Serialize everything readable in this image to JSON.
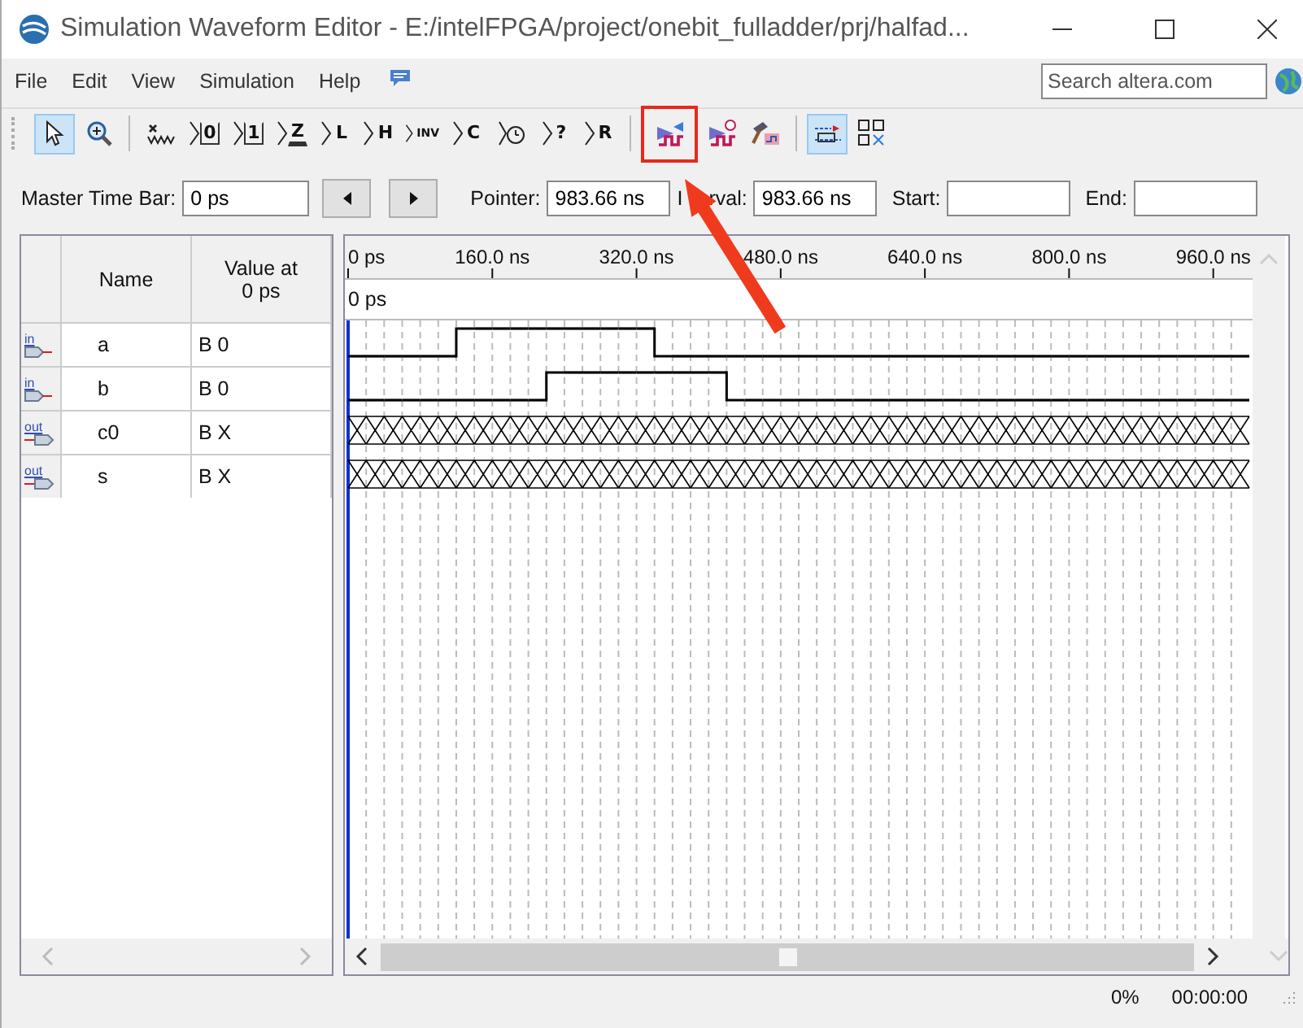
{
  "window": {
    "title": "Simulation Waveform Editor - E:/intelFPGA/project/onebit_fulladder/prj/halfad..."
  },
  "menu": [
    "File",
    "Edit",
    "View",
    "Simulation",
    "Help"
  ],
  "search": {
    "placeholder": "Search altera.com"
  },
  "toolbar": [
    {
      "kind": "pointer",
      "selected": true,
      "highlighted": false
    },
    {
      "kind": "zoom",
      "selected": false,
      "highlighted": false
    },
    {
      "kind": "separator"
    },
    {
      "kind": "unknown",
      "selected": false,
      "highlighted": false
    },
    {
      "kind": "level-low",
      "glyph": "0",
      "selected": false,
      "highlighted": false
    },
    {
      "kind": "level-high",
      "glyph": "1",
      "selected": false,
      "highlighted": false
    },
    {
      "kind": "level-z",
      "glyph": "Z",
      "selected": false,
      "highlighted": false
    },
    {
      "kind": "letter",
      "glyph": "L",
      "selected": false,
      "highlighted": false
    },
    {
      "kind": "letter",
      "glyph": "H",
      "selected": false,
      "highlighted": false
    },
    {
      "kind": "invert",
      "glyph": "INV",
      "selected": false,
      "highlighted": false
    },
    {
      "kind": "letter",
      "glyph": "C",
      "selected": false,
      "highlighted": false
    },
    {
      "kind": "clock",
      "selected": false,
      "highlighted": false
    },
    {
      "kind": "letter",
      "glyph": "?",
      "selected": false,
      "highlighted": false
    },
    {
      "kind": "letter",
      "glyph": "R",
      "selected": false,
      "highlighted": false
    },
    {
      "kind": "separator"
    },
    {
      "kind": "run-functional",
      "selected": false,
      "highlighted": true
    },
    {
      "kind": "run-timing",
      "selected": false,
      "highlighted": false
    },
    {
      "kind": "netlist",
      "selected": false,
      "highlighted": false
    },
    {
      "kind": "separator"
    },
    {
      "kind": "snap",
      "selected": true,
      "highlighted": false
    },
    {
      "kind": "grid",
      "selected": false,
      "highlighted": false
    }
  ],
  "annotation_arrow": true,
  "time_bar": {
    "master_label": "Master Time Bar:",
    "master_value": "0 ps",
    "pointer_label": "Pointer:",
    "pointer_value": "983.66 ns",
    "interval_label_parts": [
      "I",
      "rval:"
    ],
    "interval_value": "983.66 ns",
    "start_label": "Start:",
    "end_label": "End:"
  },
  "signal_table": {
    "columns": [
      "Name",
      "Value at\n0 ps"
    ],
    "rows": [
      {
        "direction": "in",
        "name": "a",
        "value": "B 0",
        "kind": "binary",
        "levels": [
          false,
          false,
          false,
          false,
          false,
          false,
          true,
          true,
          true,
          true,
          true,
          true,
          true,
          true,
          true,
          true,
          true,
          false,
          false,
          false,
          false,
          false,
          false,
          false,
          false,
          false,
          false,
          false,
          false,
          false,
          false,
          false,
          false,
          false,
          false,
          false,
          false,
          false,
          false,
          false,
          false,
          false,
          false,
          false,
          false,
          false,
          false,
          false,
          false,
          false
        ]
      },
      {
        "direction": "in",
        "name": "b",
        "value": "B 0",
        "kind": "binary",
        "levels": [
          false,
          false,
          false,
          false,
          false,
          false,
          false,
          false,
          false,
          false,
          false,
          true,
          true,
          true,
          true,
          true,
          true,
          true,
          true,
          true,
          true,
          false,
          false,
          false,
          false,
          false,
          false,
          false,
          false,
          false,
          false,
          false,
          false,
          false,
          false,
          false,
          false,
          false,
          false,
          false,
          false,
          false,
          false,
          false,
          false,
          false,
          false,
          false,
          false,
          false
        ]
      },
      {
        "direction": "out",
        "name": "c0",
        "value": "B X",
        "kind": "unknown"
      },
      {
        "direction": "out",
        "name": "s",
        "value": "B X",
        "kind": "unknown"
      }
    ]
  },
  "waveform": {
    "ruler_labels": [
      "0 ps",
      "160.0 ns",
      "320.0 ns",
      "480.0 ns",
      "640.0 ns",
      "800.0 ns",
      "960.0 ns"
    ],
    "cursor_label": "0 ps"
  },
  "status_bar": {
    "progress": "0%",
    "elapsed": "00:00:00"
  }
}
